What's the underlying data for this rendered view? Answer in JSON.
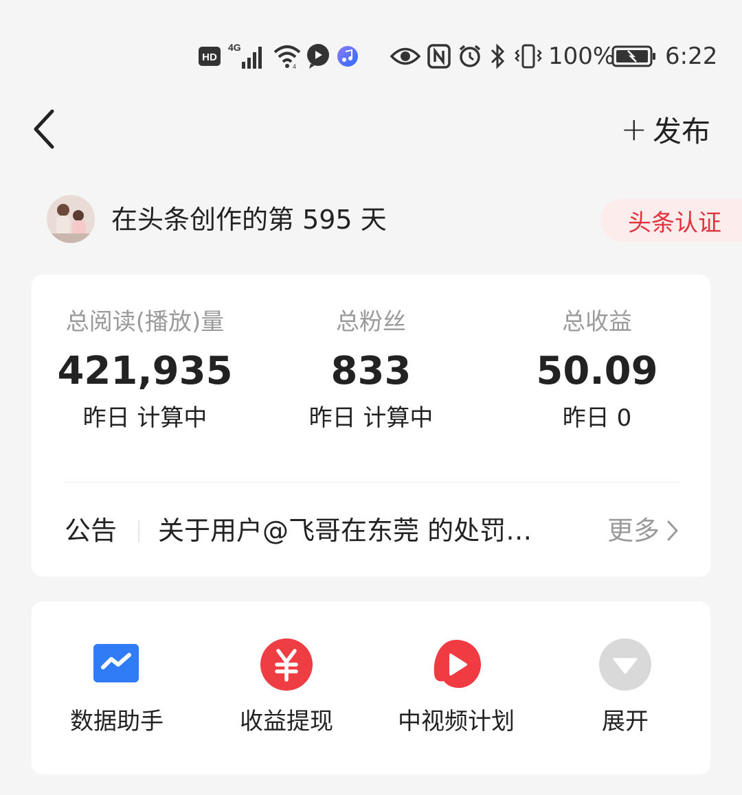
{
  "status_bar": {
    "hd_badge": "HD",
    "network": "4G",
    "battery_percent": "100%",
    "time": "6:22",
    "icons": [
      "hd-icon",
      "signal-icon",
      "wifi-icon",
      "message-icon",
      "music-icon",
      "eye-icon",
      "nfc-icon",
      "alarm-icon",
      "bluetooth-icon",
      "vibrate-icon",
      "battery-icon"
    ]
  },
  "header": {
    "publish_label": "发布",
    "publish_plus": "+"
  },
  "profile": {
    "creation_text": "在头条创作的第 595 天",
    "verify_label": "头条认证"
  },
  "stats": [
    {
      "label": "总阅读(播放)量",
      "value": "421,935",
      "sub": "昨日 计算中"
    },
    {
      "label": "总粉丝",
      "value": "833",
      "sub": "昨日 计算中"
    },
    {
      "label": "总收益",
      "value": "50.09",
      "sub": "昨日 0"
    }
  ],
  "notice": {
    "label": "公告",
    "text": "关于用户@飞哥在东莞 的处罚…",
    "more_label": "更多"
  },
  "tools": [
    {
      "label": "数据助手",
      "icon": "data-assistant-icon"
    },
    {
      "label": "收益提现",
      "icon": "yuan-withdraw-icon"
    },
    {
      "label": "中视频计划",
      "icon": "video-play-icon"
    },
    {
      "label": "展开",
      "icon": "expand-down-icon"
    }
  ],
  "colors": {
    "background": "#f5f5f5",
    "accent_red": "#e0333d",
    "verify_bg": "#fdecec",
    "data_blue": "#2f7cf6",
    "muted_text": "#9a9a9a"
  }
}
